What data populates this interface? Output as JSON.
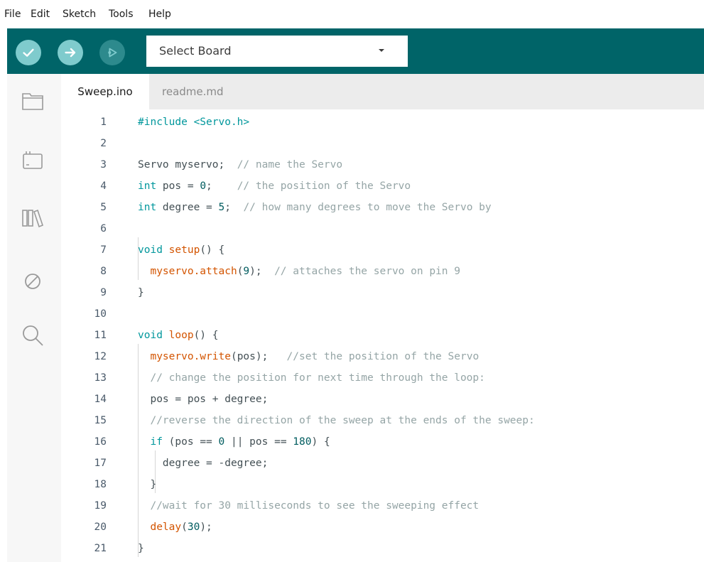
{
  "menu": [
    "File",
    "Edit",
    "Sketch",
    "Tools",
    "Help"
  ],
  "toolbar": {
    "board_select": "Select Board",
    "accent": "#006468",
    "buttons": [
      "verify-icon",
      "upload-icon",
      "debug-icon"
    ]
  },
  "sidebar": {
    "icons": [
      "sketchbook-folder-icon",
      "boards-manager-icon",
      "library-manager-icon",
      "debug-icon",
      "search-icon"
    ]
  },
  "tabs": [
    "Sweep.ino",
    "readme.md"
  ],
  "editor": {
    "lines": [
      {
        "n": "1",
        "tokens": [
          {
            "t": "#include <Servo.h>",
            "c": "kw"
          }
        ]
      },
      {
        "n": "2",
        "tokens": []
      },
      {
        "n": "3",
        "tokens": [
          {
            "t": "Servo myservo;  ",
            "c": ""
          },
          {
            "t": "// name the Servo",
            "c": "cm"
          }
        ]
      },
      {
        "n": "4",
        "tokens": [
          {
            "t": "int",
            "c": "kw"
          },
          {
            "t": " pos = ",
            "c": ""
          },
          {
            "t": "0",
            "c": "num"
          },
          {
            "t": ";    ",
            "c": ""
          },
          {
            "t": "// the position of the Servo",
            "c": "cm"
          }
        ]
      },
      {
        "n": "5",
        "tokens": [
          {
            "t": "int",
            "c": "kw"
          },
          {
            "t": " degree = ",
            "c": ""
          },
          {
            "t": "5",
            "c": "num"
          },
          {
            "t": ";  ",
            "c": ""
          },
          {
            "t": "// how many degrees to move the Servo by",
            "c": "cm"
          }
        ]
      },
      {
        "n": "6",
        "tokens": []
      },
      {
        "n": "7",
        "tokens": [
          {
            "t": "void",
            "c": "kw"
          },
          {
            "t": " ",
            "c": ""
          },
          {
            "t": "setup",
            "c": "fn"
          },
          {
            "t": "() {",
            "c": ""
          }
        ]
      },
      {
        "n": "8",
        "tokens": [
          {
            "t": "  ",
            "c": ""
          },
          {
            "t": "myservo.attach",
            "c": "fn"
          },
          {
            "t": "(",
            "c": ""
          },
          {
            "t": "9",
            "c": "num"
          },
          {
            "t": ");  ",
            "c": ""
          },
          {
            "t": "// attaches the servo on pin 9",
            "c": "cm"
          }
        ]
      },
      {
        "n": "9",
        "tokens": [
          {
            "t": "}",
            "c": ""
          }
        ]
      },
      {
        "n": "10",
        "tokens": []
      },
      {
        "n": "11",
        "tokens": [
          {
            "t": "void",
            "c": "kw"
          },
          {
            "t": " ",
            "c": ""
          },
          {
            "t": "loop",
            "c": "fn"
          },
          {
            "t": "() {",
            "c": ""
          }
        ]
      },
      {
        "n": "12",
        "tokens": [
          {
            "t": "  ",
            "c": ""
          },
          {
            "t": "myservo.write",
            "c": "fn"
          },
          {
            "t": "(pos);   ",
            "c": ""
          },
          {
            "t": "//set the position of the Servo",
            "c": "cm"
          }
        ]
      },
      {
        "n": "13",
        "tokens": [
          {
            "t": "  ",
            "c": ""
          },
          {
            "t": "// change the position for next time through the loop:",
            "c": "cm"
          }
        ]
      },
      {
        "n": "14",
        "tokens": [
          {
            "t": "  pos = pos + degree;",
            "c": ""
          }
        ]
      },
      {
        "n": "15",
        "tokens": [
          {
            "t": "  ",
            "c": ""
          },
          {
            "t": "//reverse the direction of the sweep at the ends of the sweep:",
            "c": "cm"
          }
        ]
      },
      {
        "n": "16",
        "tokens": [
          {
            "t": "  ",
            "c": ""
          },
          {
            "t": "if",
            "c": "kw"
          },
          {
            "t": " (pos == ",
            "c": ""
          },
          {
            "t": "0",
            "c": "num"
          },
          {
            "t": " || pos == ",
            "c": ""
          },
          {
            "t": "180",
            "c": "num"
          },
          {
            "t": ") {",
            "c": ""
          }
        ]
      },
      {
        "n": "17",
        "tokens": [
          {
            "t": "    degree = -degree;",
            "c": ""
          }
        ]
      },
      {
        "n": "18",
        "tokens": [
          {
            "t": "  }",
            "c": ""
          }
        ]
      },
      {
        "n": "19",
        "tokens": [
          {
            "t": "  ",
            "c": ""
          },
          {
            "t": "//wait for 30 milliseconds to see the sweeping effect",
            "c": "cm"
          }
        ]
      },
      {
        "n": "20",
        "tokens": [
          {
            "t": "  ",
            "c": ""
          },
          {
            "t": "delay",
            "c": "fn"
          },
          {
            "t": "(",
            "c": ""
          },
          {
            "t": "30",
            "c": "num"
          },
          {
            "t": ");",
            "c": ""
          }
        ]
      },
      {
        "n": "21",
        "tokens": [
          {
            "t": "}",
            "c": ""
          }
        ]
      }
    ]
  }
}
